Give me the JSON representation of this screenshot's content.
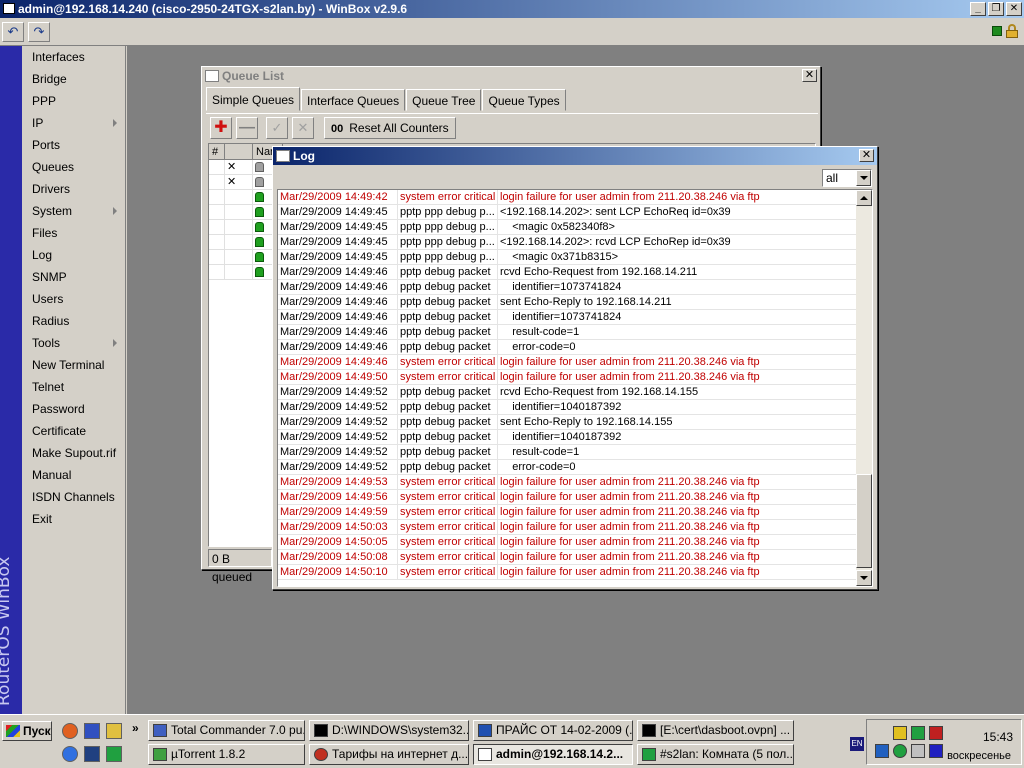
{
  "app": {
    "title": "admin@192.168.14.240 (cisco-2950-24TGX-s2lan.by) - WinBox v2.9.6",
    "brand": "RouterOS WinBox",
    "colors": {
      "title_blue": "#0a246a",
      "brand_strip": "#2a2aa8",
      "error_red": "#c00000"
    }
  },
  "toolbar": {
    "undo_icon": "undo-icon",
    "redo_icon": "redo-icon"
  },
  "menu": {
    "items": [
      {
        "label": "Interfaces"
      },
      {
        "label": "Bridge"
      },
      {
        "label": "PPP"
      },
      {
        "label": "IP"
      },
      {
        "label": "Ports"
      },
      {
        "label": "Queues"
      },
      {
        "label": "Drivers"
      },
      {
        "label": "System"
      },
      {
        "label": "Files"
      },
      {
        "label": "Log"
      },
      {
        "label": "SNMP"
      },
      {
        "label": "Users"
      },
      {
        "label": "Radius"
      },
      {
        "label": "Tools"
      },
      {
        "label": "New Terminal"
      },
      {
        "label": "Telnet"
      },
      {
        "label": "Password"
      },
      {
        "label": "Certificate"
      },
      {
        "label": "Make Supout.rif"
      },
      {
        "label": "Manual"
      },
      {
        "label": "ISDN Channels"
      },
      {
        "label": "Exit"
      }
    ]
  },
  "queue_window": {
    "title": "Queue List",
    "tabs": [
      "Simple Queues",
      "Interface Queues",
      "Queue Tree",
      "Queue Types"
    ],
    "reset_prefix": "00",
    "reset_label": "Reset All Counters",
    "headers": [
      "#",
      "",
      "Nar"
    ],
    "status": "0 B queued"
  },
  "log_window": {
    "title": "Log",
    "filter_value": "all",
    "rows": [
      {
        "time": "Mar/29/2009 14:49:42",
        "topic": "system error critical",
        "msg": "login failure for user admin from 211.20.38.246 via ftp",
        "err": true
      },
      {
        "time": "Mar/29/2009 14:49:45",
        "topic": "pptp ppp debug p...",
        "msg": "<192.168.14.202>: sent LCP EchoReq id=0x39",
        "err": false
      },
      {
        "time": "Mar/29/2009 14:49:45",
        "topic": "pptp ppp debug p...",
        "msg": "    <magic 0x582340f8>",
        "err": false
      },
      {
        "time": "Mar/29/2009 14:49:45",
        "topic": "pptp ppp debug p...",
        "msg": "<192.168.14.202>: rcvd LCP EchoRep id=0x39",
        "err": false
      },
      {
        "time": "Mar/29/2009 14:49:45",
        "topic": "pptp ppp debug p...",
        "msg": "    <magic 0x371b8315>",
        "err": false
      },
      {
        "time": "Mar/29/2009 14:49:46",
        "topic": "pptp debug packet",
        "msg": "rcvd Echo-Request from 192.168.14.211",
        "err": false
      },
      {
        "time": "Mar/29/2009 14:49:46",
        "topic": "pptp debug packet",
        "msg": "    identifier=1073741824",
        "err": false
      },
      {
        "time": "Mar/29/2009 14:49:46",
        "topic": "pptp debug packet",
        "msg": "sent Echo-Reply to 192.168.14.211",
        "err": false
      },
      {
        "time": "Mar/29/2009 14:49:46",
        "topic": "pptp debug packet",
        "msg": "    identifier=1073741824",
        "err": false
      },
      {
        "time": "Mar/29/2009 14:49:46",
        "topic": "pptp debug packet",
        "msg": "    result-code=1",
        "err": false
      },
      {
        "time": "Mar/29/2009 14:49:46",
        "topic": "pptp debug packet",
        "msg": "    error-code=0",
        "err": false
      },
      {
        "time": "Mar/29/2009 14:49:46",
        "topic": "system error critical",
        "msg": "login failure for user admin from 211.20.38.246 via ftp",
        "err": true
      },
      {
        "time": "Mar/29/2009 14:49:50",
        "topic": "system error critical",
        "msg": "login failure for user admin from 211.20.38.246 via ftp",
        "err": true
      },
      {
        "time": "Mar/29/2009 14:49:52",
        "topic": "pptp debug packet",
        "msg": "rcvd Echo-Request from 192.168.14.155",
        "err": false
      },
      {
        "time": "Mar/29/2009 14:49:52",
        "topic": "pptp debug packet",
        "msg": "    identifier=1040187392",
        "err": false
      },
      {
        "time": "Mar/29/2009 14:49:52",
        "topic": "pptp debug packet",
        "msg": "sent Echo-Reply to 192.168.14.155",
        "err": false
      },
      {
        "time": "Mar/29/2009 14:49:52",
        "topic": "pptp debug packet",
        "msg": "    identifier=1040187392",
        "err": false
      },
      {
        "time": "Mar/29/2009 14:49:52",
        "topic": "pptp debug packet",
        "msg": "    result-code=1",
        "err": false
      },
      {
        "time": "Mar/29/2009 14:49:52",
        "topic": "pptp debug packet",
        "msg": "    error-code=0",
        "err": false
      },
      {
        "time": "Mar/29/2009 14:49:53",
        "topic": "system error critical",
        "msg": "login failure for user admin from 211.20.38.246 via ftp",
        "err": true
      },
      {
        "time": "Mar/29/2009 14:49:56",
        "topic": "system error critical",
        "msg": "login failure for user admin from 211.20.38.246 via ftp",
        "err": true
      },
      {
        "time": "Mar/29/2009 14:49:59",
        "topic": "system error critical",
        "msg": "login failure for user admin from 211.20.38.246 via ftp",
        "err": true
      },
      {
        "time": "Mar/29/2009 14:50:03",
        "topic": "system error critical",
        "msg": "login failure for user admin from 211.20.38.246 via ftp",
        "err": true
      },
      {
        "time": "Mar/29/2009 14:50:05",
        "topic": "system error critical",
        "msg": "login failure for user admin from 211.20.38.246 via ftp",
        "err": true
      },
      {
        "time": "Mar/29/2009 14:50:08",
        "topic": "system error critical",
        "msg": "login failure for user admin from 211.20.38.246 via ftp",
        "err": true
      },
      {
        "time": "Mar/29/2009 14:50:10",
        "topic": "system error critical",
        "msg": "login failure for user admin from 211.20.38.246 via ftp",
        "err": true
      }
    ]
  },
  "taskbar": {
    "start_label": "Пуск",
    "tasks_row1": [
      "Total Commander 7.0 pu...",
      "D:\\WINDOWS\\system32...",
      "ПРАЙС ОТ 14-02-2009 (...",
      "[E:\\cert\\dasboot.ovpn] ..."
    ],
    "tasks_row2": [
      "µTorrent 1.8.2",
      "Тарифы на интернет д...",
      "admin@192.168.14.2...",
      "#s2lan: Комната (5 пол..."
    ],
    "lang": "EN",
    "clock": "15:43",
    "day": "воскресенье"
  }
}
